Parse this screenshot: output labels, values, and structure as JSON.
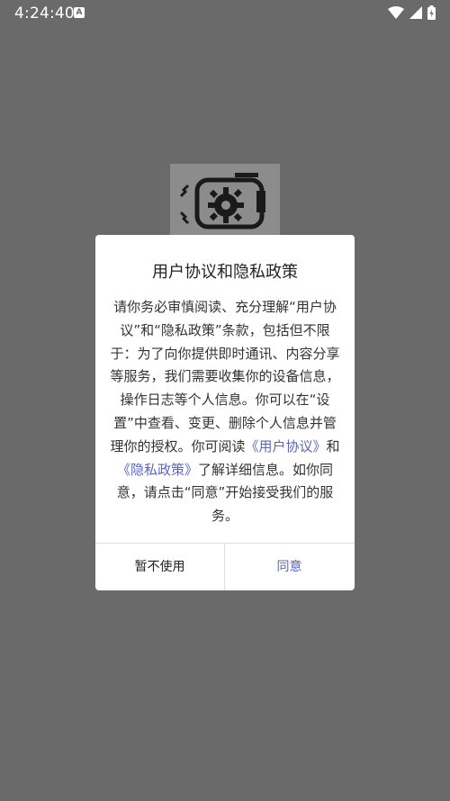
{
  "status_bar": {
    "time": "4:24:40",
    "notification_icon": "A"
  },
  "dialog": {
    "title": "用户协议和隐私政策",
    "body": {
      "part1": "请你务必审慎阅读、充分理解“用户协议”和“隐私政策”条款，包括但不限于：为了向你提供即时通讯、内容分享等服务，我们需要收集你的设备信息，操作日志等个人信息。你可以在“设置”中查看、变更、删除个人信息并管理你的授权。你可阅读",
      "link_user_agreement": "《用户协议》",
      "and": "和",
      "link_privacy_policy": "《隐私政策》",
      "part2": "了解详细信息。如你同意，请点击“同意”开始接受我们的服务。"
    },
    "decline_label": "暂不使用",
    "agree_label": "同意"
  },
  "colors": {
    "accent": "#5a64c8",
    "background": "#6a6a6a"
  }
}
